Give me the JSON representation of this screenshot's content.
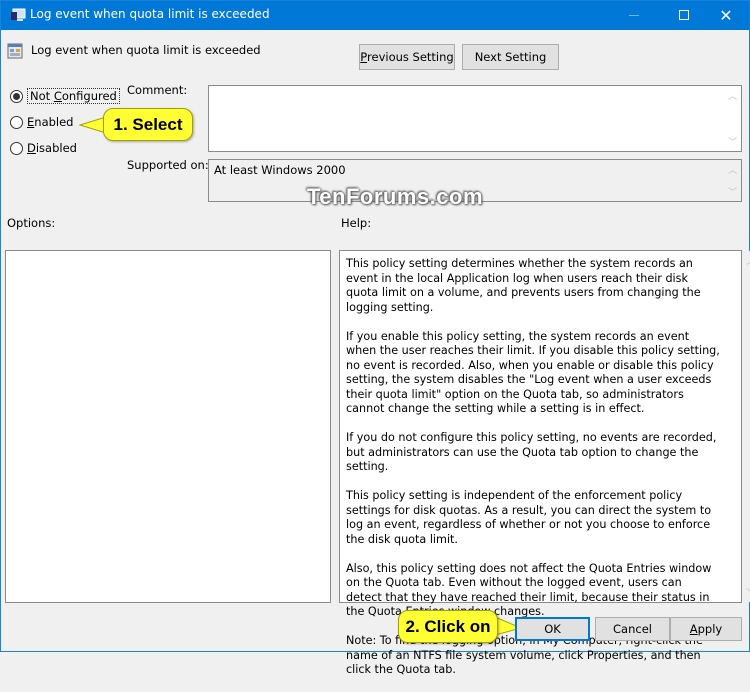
{
  "window": {
    "title": "Log event when quota limit is exceeded",
    "controls": {
      "minimize": "minimize",
      "maximize": "maximize",
      "close": "close"
    }
  },
  "header": {
    "policy_title": "Log event when quota limit is exceeded",
    "previous_setting": {
      "label_accel": "P",
      "label_rest": "revious Setting"
    },
    "next_setting": "Next Setting"
  },
  "state_options": [
    {
      "accel": "",
      "pre": "Not ",
      "key": "C",
      "post": "onfigured",
      "selected": true
    },
    {
      "accel": "E",
      "rest": "nabled",
      "selected": false
    },
    {
      "accel": "D",
      "rest": "isabled",
      "selected": false
    }
  ],
  "comment": {
    "label": "Comment:",
    "value": ""
  },
  "supported_on": {
    "label": "Supported on:",
    "value": "At least Windows 2000"
  },
  "options": {
    "label": "Options:"
  },
  "help": {
    "label": "Help:",
    "paragraphs": [
      "This policy setting determines whether the system records an event in the local Application log when users reach their disk quota limit on a volume, and prevents users from changing the logging setting.",
      "If you enable this policy setting, the system records an event when the user reaches their limit. If you disable this policy setting, no event is recorded. Also, when you enable or disable this policy setting, the system disables the \"Log event when a user exceeds their quota limit\" option on the Quota tab, so administrators cannot change the setting while a setting is in effect.",
      "If you do not configure this policy setting, no events are recorded, but administrators can use the Quota tab option to change the setting.",
      "This policy setting is independent of the enforcement policy settings for disk quotas. As a result, you can direct the system to log an event, regardless of whether or not you choose to enforce the disk quota limit.",
      "Also, this policy setting does not affect the Quota Entries window on the Quota tab. Even without the logged event, users can detect that they have reached their limit, because their status in the Quota Entries window changes.",
      "Note: To find the logging option, in My Computer, right-click the name of an NTFS file system volume, click Properties, and then click the Quota tab."
    ]
  },
  "footer": {
    "ok": "OK",
    "cancel": "Cancel",
    "apply": {
      "accel": "A",
      "rest": "pply"
    }
  },
  "annotations": {
    "callout_1": "1. Select",
    "callout_2": "2. Click on",
    "watermark": "TenForums.com"
  },
  "colors": {
    "titlebar": "#0078d7",
    "callout": "#ffff33",
    "dialog_bg": "#f0f0f0"
  }
}
